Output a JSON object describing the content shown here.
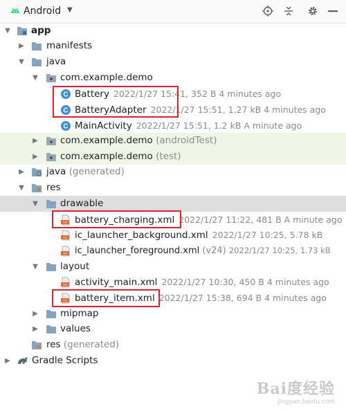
{
  "toolbar": {
    "view_name": "Android",
    "icons": [
      "android-icon",
      "target-icon",
      "collapse-all-icon",
      "settings-icon",
      "hide-icon"
    ]
  },
  "tree": {
    "app": "app",
    "manifests": "manifests",
    "java": "java",
    "pkg_main": "com.example.demo",
    "battery": {
      "name": "Battery",
      "meta": "2022/1/27 15:41, 352 B 4 minutes ago"
    },
    "battery_adapter": {
      "name": "BatteryAdapter",
      "meta": "2022/1/27 15:51, 1.27 kB 4 minutes ago"
    },
    "main_activity": {
      "name": "MainActivity",
      "meta": "2022/1/27 15:51, 1.2 kB A minute ago"
    },
    "pkg_android_test": {
      "name": "com.example.demo",
      "suffix": "(androidTest)"
    },
    "pkg_test": {
      "name": "com.example.demo",
      "suffix": "(test)"
    },
    "java_generated": {
      "name": "java",
      "suffix": "(generated)"
    },
    "res": "res",
    "drawable": "drawable",
    "battery_charging": {
      "name": "battery_charging.xml",
      "meta": "2022/1/27 11:22, 481 B A minute ago"
    },
    "ic_launcher_background": {
      "name": "ic_launcher_background.xml",
      "meta": "2022/1/27 10:25, 5.78 kB"
    },
    "ic_launcher_foreground": {
      "name": "ic_launcher_foreground.xml",
      "suffix": "(v24)",
      "meta": "2022/1/27 10:25, 1.73 kB"
    },
    "layout": "layout",
    "activity_main": {
      "name": "activity_main.xml",
      "meta": "2022/1/27 10:30, 450 B 4 minutes ago"
    },
    "battery_item": {
      "name": "battery_item.xml",
      "meta": "2022/1/27 15:38, 694 B 4 minutes ago"
    },
    "mipmap": "mipmap",
    "values": "values",
    "res_generated": {
      "name": "res",
      "suffix": "(generated)"
    },
    "gradle_scripts": "Gradle Scripts"
  },
  "watermark": {
    "main": "Bai度经验",
    "sub": "jingyan.baidu.com"
  },
  "colors": {
    "highlight_border": "#e0202a",
    "folder": "#87a3bf",
    "class_icon": "#3d8fd6",
    "xml_icon": "#e36b3a",
    "test_row_bg": "#eef6e8",
    "selected_row_bg": "#dedede",
    "android_green": "#3ddc84"
  }
}
